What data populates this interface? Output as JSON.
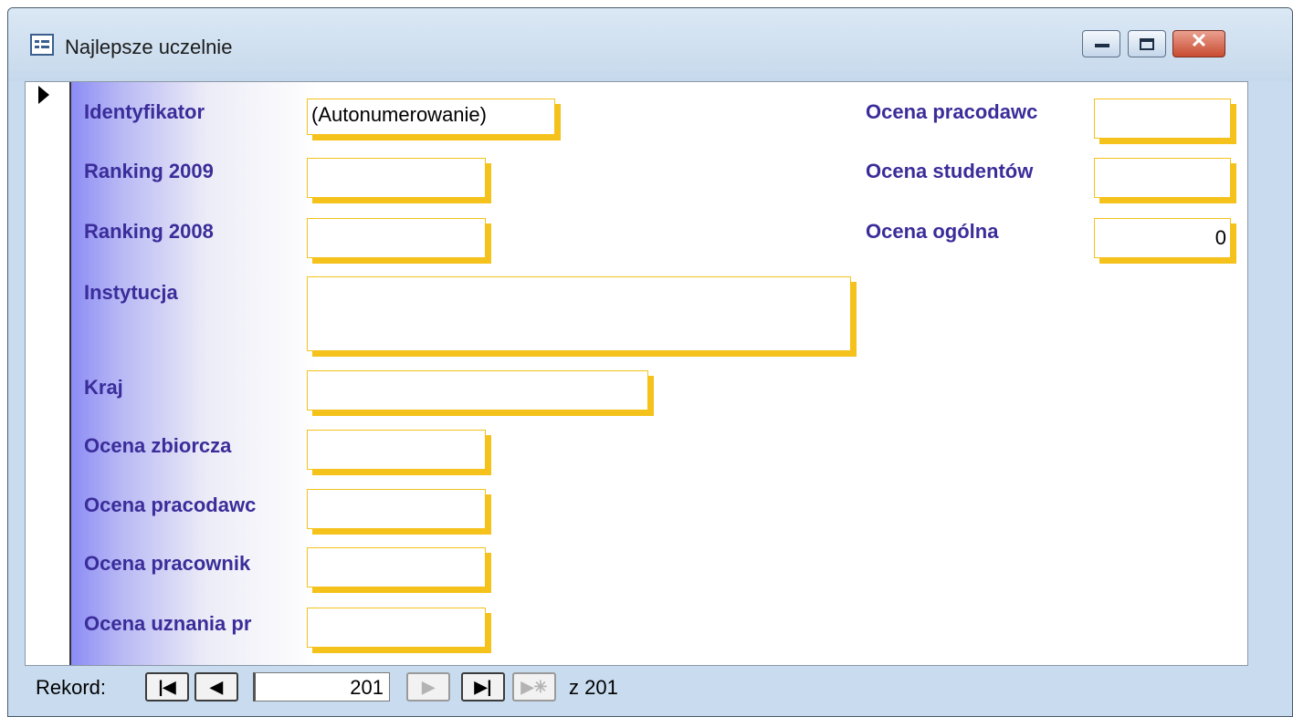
{
  "window": {
    "title": "Najlepsze uczelnie",
    "icon": "form-icon",
    "controls": {
      "minimize": "minimize-icon",
      "maximize": "maximize-icon",
      "close": "✕"
    }
  },
  "form": {
    "current_record_marker": "record-selector-arrow-icon",
    "fields": {
      "identyfikator": {
        "label": "Identyfikator",
        "value": "(Autonumerowanie)"
      },
      "ranking_2009": {
        "label": "Ranking 2009",
        "value": ""
      },
      "ranking_2008": {
        "label": "Ranking 2008",
        "value": ""
      },
      "instytucja": {
        "label": "Instytucja",
        "value": ""
      },
      "kraj": {
        "label": "Kraj",
        "value": ""
      },
      "ocena_zbiorcza": {
        "label": "Ocena zbiorcza",
        "value": ""
      },
      "ocena_pracodawcow_left": {
        "label": "Ocena pracodawc",
        "value": ""
      },
      "ocena_pracownikow": {
        "label": "Ocena pracownik",
        "value": ""
      },
      "ocena_uznania": {
        "label": "Ocena uznania pr",
        "value": ""
      },
      "ocena_pracodawcow_right": {
        "label": "Ocena pracodawc",
        "value": ""
      },
      "ocena_studentow": {
        "label": "Ocena studentów",
        "value": ""
      },
      "ocena_ogolna": {
        "label": "Ocena ogólna",
        "value": "0"
      }
    }
  },
  "navigation": {
    "label": "Rekord:",
    "current_record": "201",
    "of_label": "z  201",
    "buttons": {
      "first": "|◀",
      "prev": "◀",
      "next": "▶",
      "last": "▶|",
      "new": "▶✳"
    }
  },
  "colors": {
    "label_text": "#3a2d9a",
    "field_border": "#f4c21a",
    "gradient_start": "#8c8cf5"
  }
}
